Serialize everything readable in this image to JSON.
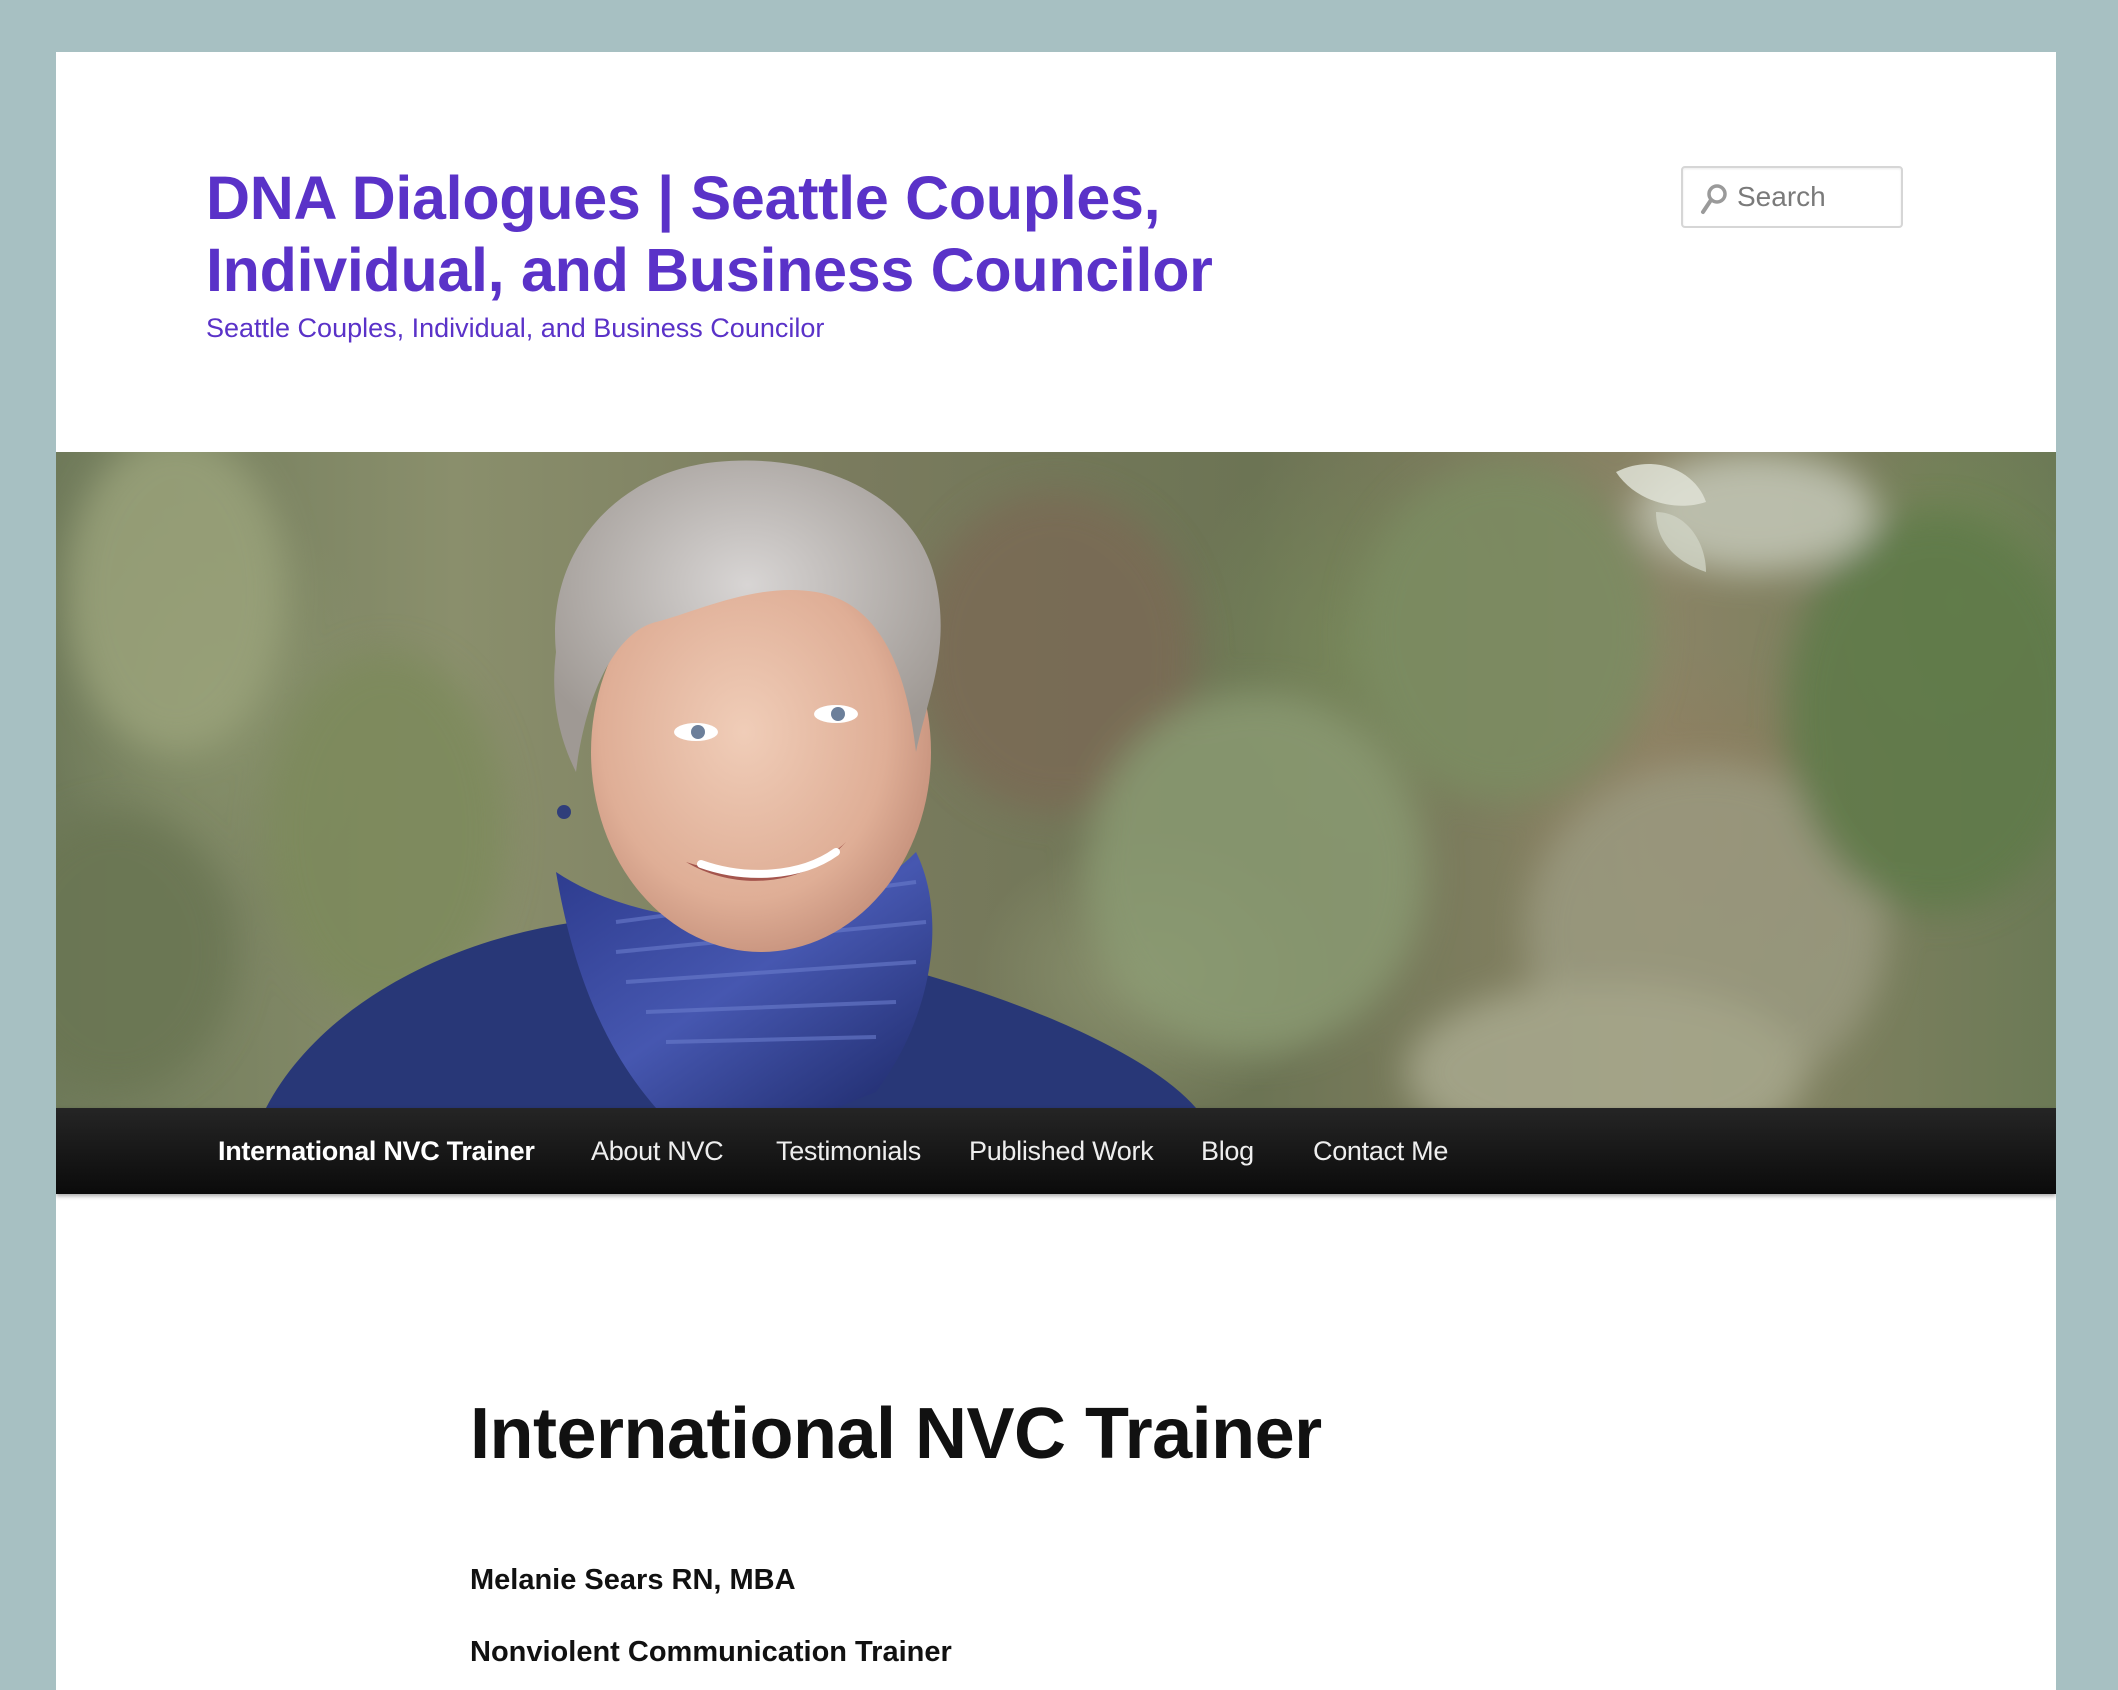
{
  "header": {
    "site_title": "DNA Dialogues | Seattle Couples, Individual, and Business Councilor",
    "tagline": "Seattle Couples, Individual, and Business Councilor"
  },
  "search": {
    "placeholder": "Search",
    "icon": "search-icon"
  },
  "hero": {
    "image": "header-photo-woman-smiling"
  },
  "nav": {
    "items": [
      {
        "label": "International NVC Trainer",
        "current": true
      },
      {
        "label": "About NVC"
      },
      {
        "label": "Testimonials"
      },
      {
        "label": "Published Work"
      },
      {
        "label": "Blog"
      },
      {
        "label": "Contact Me"
      }
    ]
  },
  "content": {
    "title": "International NVC Trainer",
    "lines": [
      "Melanie Sears RN, MBA",
      "Nonviolent Communication Trainer"
    ]
  },
  "colors": {
    "background": "#a7c0c2",
    "title": "#5a32c8",
    "nav_bg": "#151515",
    "nav_text": "#eeeeee"
  }
}
